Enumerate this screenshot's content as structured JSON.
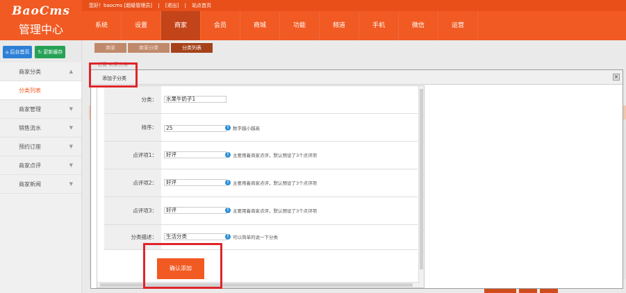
{
  "brand": {
    "logo": "BaoCms",
    "subtitle": "管理中心"
  },
  "topbar": {
    "greeting": "您好！baocms [超级管理员]",
    "links": [
      "[退出]",
      "站点首页"
    ],
    "nav": [
      "系统",
      "设置",
      "商家",
      "会员",
      "商城",
      "功能",
      "频道",
      "手机",
      "微信",
      "运营"
    ],
    "active_nav": "商家"
  },
  "sidebar": {
    "home_button": "后台首页",
    "cache_button": "更新缓存",
    "items": [
      {
        "label": "商家分类",
        "arrow": "▲"
      },
      {
        "label": "分类列表",
        "arrow": ""
      },
      {
        "label": "商家管理",
        "arrow": "▼"
      },
      {
        "label": "销售流水",
        "arrow": "▼"
      },
      {
        "label": "预约订座",
        "arrow": "▼"
      },
      {
        "label": "商家点评",
        "arrow": "▼"
      },
      {
        "label": "商家新闻",
        "arrow": "▼"
      }
    ]
  },
  "breadcrumb": [
    "商家",
    "商家分类",
    "分类列表"
  ],
  "background_text": "设置  商家分类",
  "dialog": {
    "title": "添加子分类",
    "close": "×",
    "fields": [
      {
        "label": "分类：",
        "value": "水果牛奶子1",
        "hint": ""
      },
      {
        "label": "排序：",
        "value": "25",
        "hint": "数字越小越高"
      },
      {
        "label": "点评项1：",
        "value": "好评",
        "hint": "主要用着商家点评，默认预设了3个点评项"
      },
      {
        "label": "点评项2：",
        "value": "好评",
        "hint": "主要用着商家点评，默认预设了3个点评项"
      },
      {
        "label": "点评项3：",
        "value": "好评",
        "hint": "主要用着商家点评，默认预设了3个点评项"
      },
      {
        "label": "分类描述：",
        "value": "生活分类",
        "hint": "可以简单的说一下分类"
      }
    ],
    "submit_label": "确认添加"
  },
  "colors": {
    "primary": "#f15a22",
    "highlight": "#e0242a",
    "info": "#2a8fd6"
  }
}
